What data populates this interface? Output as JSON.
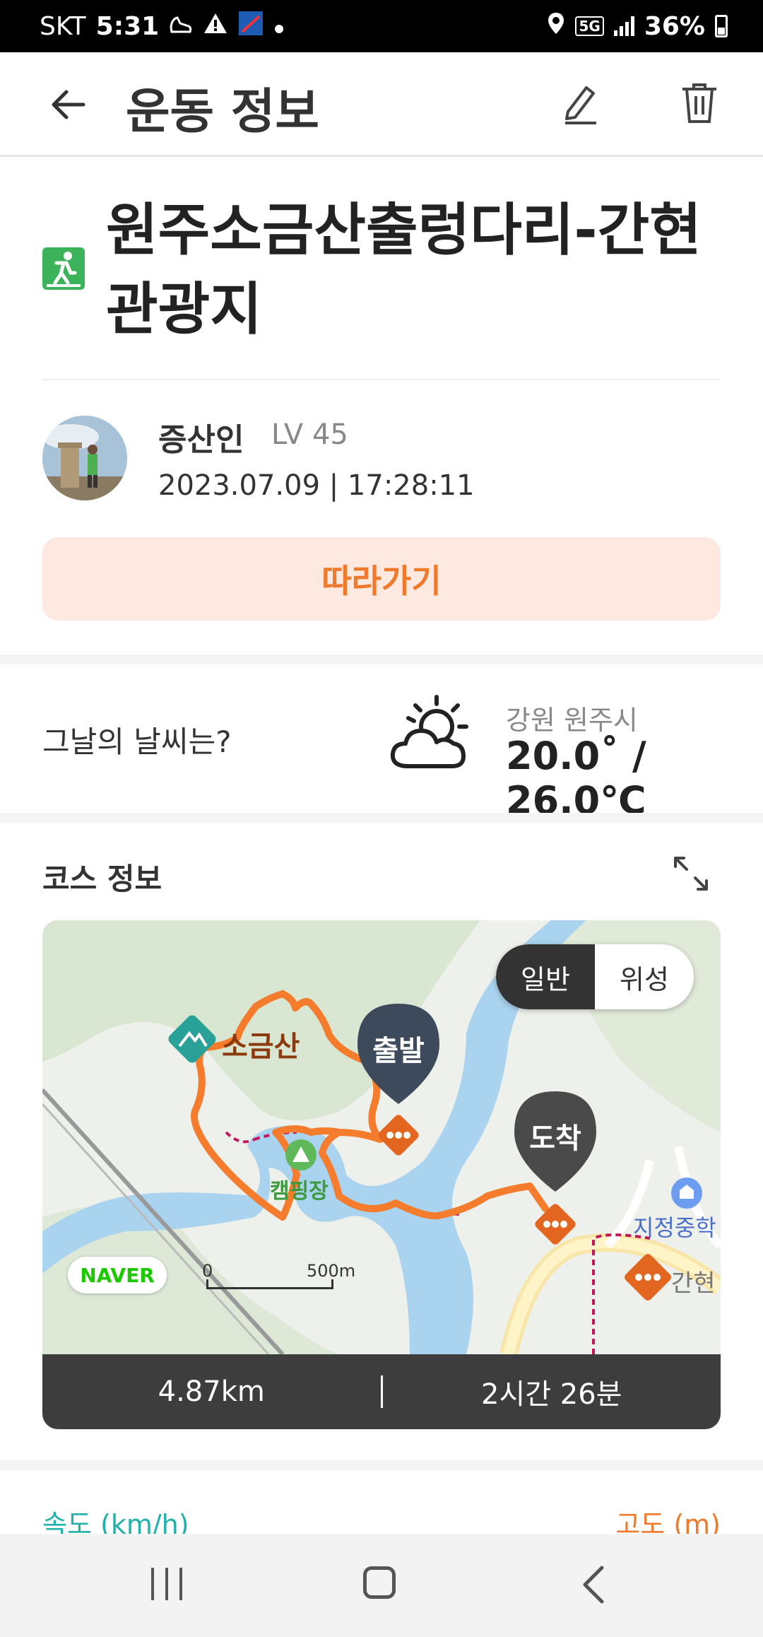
{
  "status_bar": {
    "carrier": "SKT",
    "time": "5:31",
    "network": "5G",
    "battery": "36%",
    "icons": [
      "shoe-icon",
      "warning-icon",
      "app-badge-icon",
      "dot-icon",
      "location-icon",
      "signal-icon",
      "battery-icon"
    ]
  },
  "app_bar": {
    "title": "운동 정보",
    "back_icon": "back-arrow-icon",
    "edit_icon": "pencil-icon",
    "delete_icon": "trash-icon"
  },
  "activity": {
    "title": "원주소금산출렁다리-간현관광지",
    "type_icon": "hiking-icon"
  },
  "user": {
    "name": "증산인",
    "level": "LV 45",
    "datetime": "2023.07.09 | 17:28:11"
  },
  "follow_button": {
    "label": "따라가기"
  },
  "weather": {
    "question": "그날의 날씨는?",
    "location": "강원 원주시",
    "temperature": "20.0˚ / 26.0℃",
    "icon": "partly-cloudy-icon"
  },
  "course": {
    "label": "코스 정보",
    "expand_icon": "expand-icon",
    "map": {
      "toggle_general": "일반",
      "toggle_satellite": "위성",
      "mountain_label": "소금산",
      "camping_label": "캠핑장",
      "school_label": "지정중학",
      "town_label": "간현",
      "start_label": "출발",
      "end_label": "도착",
      "naver_logo": "NAVER",
      "scale_start": "0",
      "scale_end": "500m"
    },
    "distance": "4.87km",
    "duration": "2시간 26분"
  },
  "charts": {
    "speed_label": "속도 (km/h)",
    "altitude_label": "고도 (m)"
  },
  "colors": {
    "accent": "#f07a2c",
    "follow_bg": "#fde9df",
    "speed": "#20b2aa",
    "hiking_green": "#3cb35a",
    "map_water": "#a9d3ee",
    "map_route": "#f47c2c"
  }
}
